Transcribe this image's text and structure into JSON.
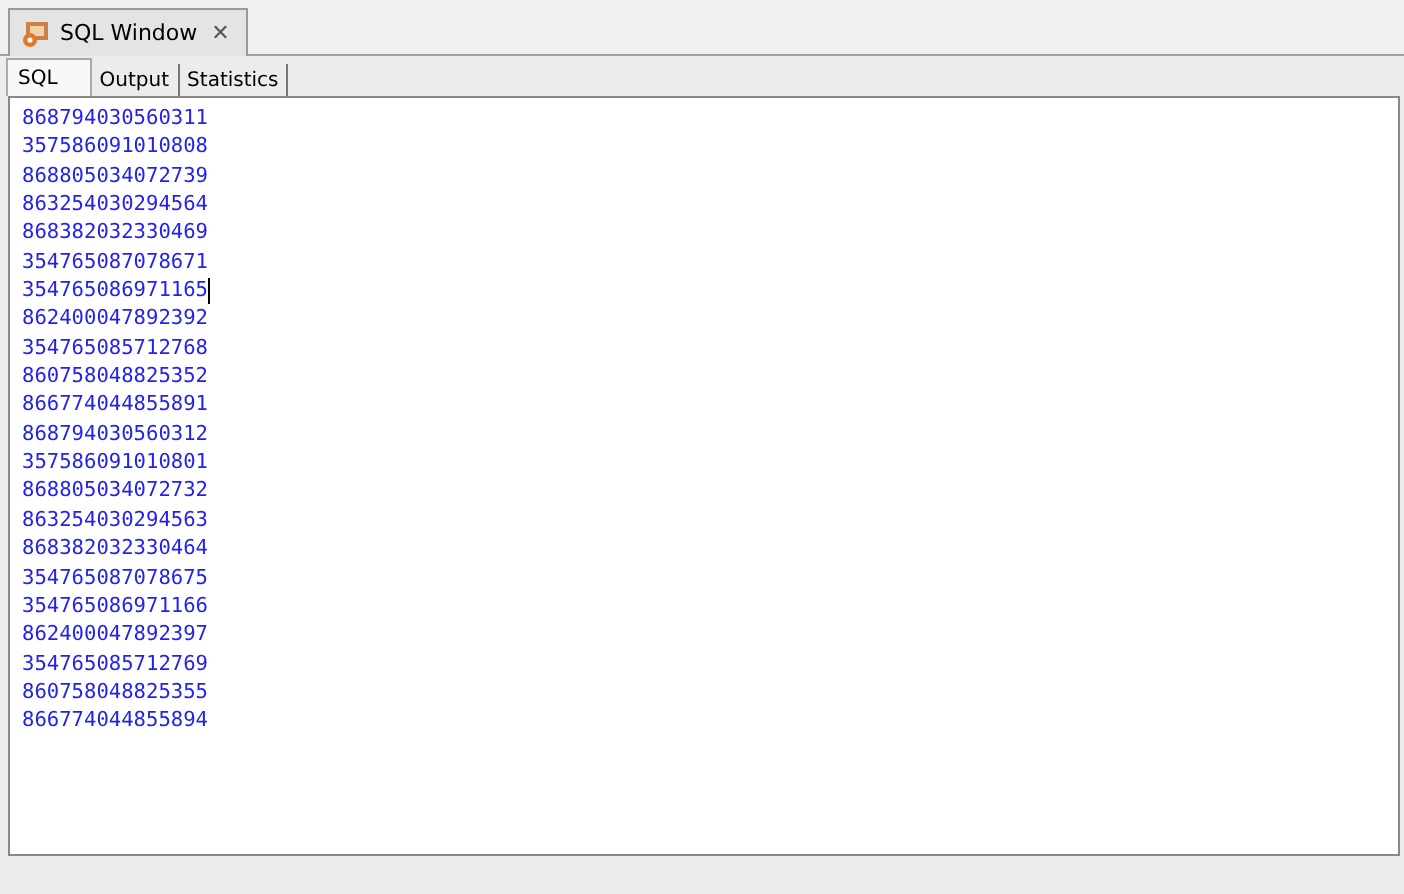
{
  "window_tab": {
    "title": "SQL Window",
    "close": "✕"
  },
  "tabs": [
    {
      "label": "SQL",
      "selected": true
    },
    {
      "label": "Output",
      "selected": false
    },
    {
      "label": "Statistics",
      "selected": false
    }
  ],
  "editor": {
    "lines": [
      {
        "text": "868794030560311",
        "cursor": false
      },
      {
        "text": "357586091010808",
        "cursor": false
      },
      {
        "text": "868805034072739",
        "cursor": false
      },
      {
        "text": "863254030294564",
        "cursor": false
      },
      {
        "text": "868382032330469",
        "cursor": false
      },
      {
        "text": "354765087078671",
        "cursor": false
      },
      {
        "text": "354765086971165",
        "cursor": true
      },
      {
        "text": "862400047892392",
        "cursor": false
      },
      {
        "text": "354765085712768",
        "cursor": false
      },
      {
        "text": "860758048825352",
        "cursor": false
      },
      {
        "text": "866774044855891",
        "cursor": false
      },
      {
        "text": "868794030560312",
        "cursor": false
      },
      {
        "text": "357586091010801",
        "cursor": false
      },
      {
        "text": "868805034072732",
        "cursor": false
      },
      {
        "text": "863254030294563",
        "cursor": false
      },
      {
        "text": "868382032330464",
        "cursor": false
      },
      {
        "text": "354765087078675",
        "cursor": false
      },
      {
        "text": "354765086971166",
        "cursor": false
      },
      {
        "text": "862400047892397",
        "cursor": false
      },
      {
        "text": "354765085712769",
        "cursor": false
      },
      {
        "text": "860758048825355",
        "cursor": false
      },
      {
        "text": "866774044855894",
        "cursor": false
      }
    ]
  }
}
